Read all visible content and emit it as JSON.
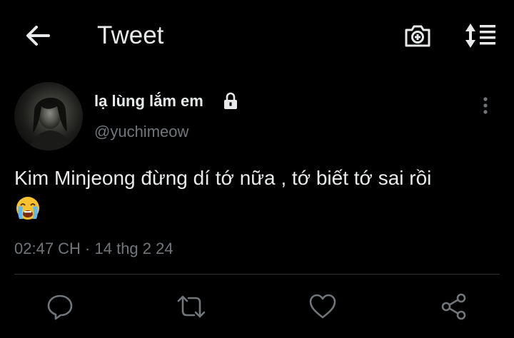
{
  "header": {
    "title": "Tweet",
    "back_icon": "arrow-left-icon",
    "camera_icon": "camera-plus-icon",
    "sort_icon": "sort-lines-icon"
  },
  "author": {
    "display_name": "lạ lùng lắm em",
    "handle": "@yuchimeow",
    "protected_icon": "lock-icon",
    "avatar_icon": "avatar-photo"
  },
  "tweet": {
    "text": "Kim Minjeong đừng dí tớ nữa , tớ biết tớ sai rồi",
    "emoji": "loudly-crying-face",
    "timestamp": "02:47 CH · 14 thg 2 24"
  },
  "actions": [
    {
      "name": "reply",
      "icon": "reply-bubble-icon"
    },
    {
      "name": "retweet",
      "icon": "retweet-icon"
    },
    {
      "name": "like",
      "icon": "heart-icon"
    },
    {
      "name": "share",
      "icon": "share-icon"
    }
  ],
  "colors": {
    "background": "#000000",
    "text_primary": "#e7e9ea",
    "text_secondary": "#71767b",
    "divider": "#2f3336"
  }
}
